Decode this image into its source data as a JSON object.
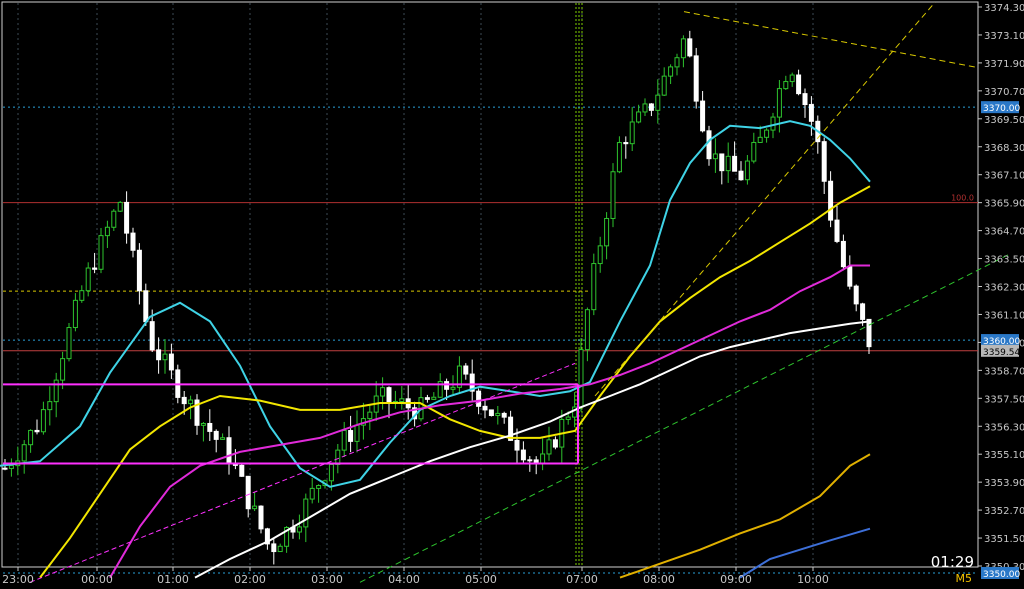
{
  "chart_data": {
    "type": "candlestick",
    "timeframe": "M5",
    "countdown": "01:29",
    "y_range": [
      3349.6,
      3374.5
    ],
    "y_ticks": [
      "3374.30",
      "3373.10",
      "3371.90",
      "3370.70",
      "3369.50",
      "3368.30",
      "3367.10",
      "3365.90",
      "3364.70",
      "3363.50",
      "3362.30",
      "3361.10",
      "3359.90",
      "3358.70",
      "3357.50",
      "3356.30",
      "3355.10",
      "3353.90",
      "3352.70",
      "3351.50",
      "3350.30"
    ],
    "x_ticks": [
      "23:00",
      "00:00",
      "01:00",
      "02:00",
      "03:00",
      "04:00",
      "05:00",
      "07:00",
      "08:00",
      "09:00",
      "10:00"
    ],
    "price_lines": [
      {
        "label": "3370.00",
        "value": 3370.0,
        "color": "#2a78c8"
      },
      {
        "label": "3360.00",
        "value": 3360.0,
        "color": "#2a78c8"
      },
      {
        "label": "3359.54",
        "value": 3359.54,
        "color": "#b0b0b0"
      },
      {
        "label": "3350.00",
        "value": 3350.0,
        "color": "#2a78c8"
      }
    ],
    "fibo_label": "100.0",
    "series": [
      {
        "name": "MA fast",
        "color": "#3fd3e6",
        "points": [
          [
            0,
            3354.6
          ],
          [
            40,
            3354.8
          ],
          [
            80,
            3356.3
          ],
          [
            110,
            3358.6
          ],
          [
            150,
            3361.0
          ],
          [
            180,
            3361.6
          ],
          [
            210,
            3360.8
          ],
          [
            240,
            3358.9
          ],
          [
            270,
            3356.3
          ],
          [
            300,
            3354.5
          ],
          [
            330,
            3353.7
          ],
          [
            360,
            3354.0
          ],
          [
            390,
            3355.6
          ],
          [
            420,
            3357.0
          ],
          [
            450,
            3357.6
          ],
          [
            480,
            3358.0
          ],
          [
            510,
            3357.8
          ],
          [
            540,
            3357.6
          ],
          [
            570,
            3357.8
          ],
          [
            590,
            3358.2
          ],
          [
            620,
            3360.8
          ],
          [
            650,
            3363.2
          ],
          [
            670,
            3366.0
          ],
          [
            690,
            3367.6
          ],
          [
            710,
            3368.6
          ],
          [
            730,
            3369.2
          ],
          [
            760,
            3369.1
          ],
          [
            790,
            3369.4
          ],
          [
            810,
            3369.2
          ],
          [
            830,
            3368.6
          ],
          [
            850,
            3367.8
          ],
          [
            870,
            3366.8
          ]
        ]
      },
      {
        "name": "MA mid",
        "color": "#f2e600",
        "points": [
          [
            40,
            3349.8
          ],
          [
            70,
            3351.5
          ],
          [
            100,
            3353.4
          ],
          [
            130,
            3355.3
          ],
          [
            160,
            3356.3
          ],
          [
            190,
            3357.1
          ],
          [
            220,
            3357.6
          ],
          [
            260,
            3357.4
          ],
          [
            300,
            3357.0
          ],
          [
            340,
            3357.0
          ],
          [
            380,
            3357.3
          ],
          [
            420,
            3357.3
          ],
          [
            450,
            3356.6
          ],
          [
            480,
            3356.1
          ],
          [
            510,
            3355.8
          ],
          [
            540,
            3355.8
          ],
          [
            575,
            3356.1
          ],
          [
            600,
            3357.6
          ],
          [
            630,
            3359.3
          ],
          [
            660,
            3360.8
          ],
          [
            690,
            3361.8
          ],
          [
            720,
            3362.7
          ],
          [
            750,
            3363.4
          ],
          [
            780,
            3364.2
          ],
          [
            810,
            3365.0
          ],
          [
            840,
            3365.9
          ],
          [
            870,
            3366.6
          ]
        ]
      },
      {
        "name": "MA slow",
        "color": "#e02ad9",
        "points": [
          [
            110,
            3349.8
          ],
          [
            140,
            3352.0
          ],
          [
            170,
            3353.7
          ],
          [
            200,
            3354.6
          ],
          [
            240,
            3355.2
          ],
          [
            280,
            3355.5
          ],
          [
            320,
            3355.8
          ],
          [
            360,
            3356.4
          ],
          [
            400,
            3356.9
          ],
          [
            440,
            3357.2
          ],
          [
            480,
            3357.4
          ],
          [
            520,
            3357.7
          ],
          [
            560,
            3357.9
          ],
          [
            590,
            3358.1
          ],
          [
            620,
            3358.5
          ],
          [
            650,
            3359.0
          ],
          [
            680,
            3359.6
          ],
          [
            710,
            3360.2
          ],
          [
            740,
            3360.8
          ],
          [
            770,
            3361.3
          ],
          [
            800,
            3362.1
          ],
          [
            830,
            3362.7
          ],
          [
            850,
            3363.2
          ],
          [
            870,
            3363.2
          ]
        ]
      },
      {
        "name": "MA long",
        "color": "#ffffff",
        "points": [
          [
            195,
            3349.8
          ],
          [
            230,
            3350.6
          ],
          [
            270,
            3351.4
          ],
          [
            310,
            3352.4
          ],
          [
            350,
            3353.4
          ],
          [
            390,
            3354.1
          ],
          [
            430,
            3354.8
          ],
          [
            470,
            3355.4
          ],
          [
            510,
            3355.9
          ],
          [
            550,
            3356.5
          ],
          [
            580,
            3357.1
          ],
          [
            610,
            3357.6
          ],
          [
            640,
            3358.1
          ],
          [
            670,
            3358.7
          ],
          [
            700,
            3359.3
          ],
          [
            730,
            3359.7
          ],
          [
            760,
            3360.0
          ],
          [
            790,
            3360.3
          ],
          [
            820,
            3360.5
          ],
          [
            850,
            3360.7
          ],
          [
            870,
            3360.8
          ]
        ]
      },
      {
        "name": "Envelope upper",
        "color": "#e0b000",
        "points": [
          [
            620,
            3349.8
          ],
          [
            660,
            3350.4
          ],
          [
            700,
            3351.0
          ],
          [
            740,
            3351.7
          ],
          [
            780,
            3352.3
          ],
          [
            820,
            3353.3
          ],
          [
            850,
            3354.6
          ],
          [
            870,
            3355.1
          ]
        ]
      },
      {
        "name": "Envelope lower",
        "color": "#3d6fd8",
        "points": [
          [
            740,
            3349.8
          ],
          [
            770,
            3350.6
          ],
          [
            800,
            3351.0
          ],
          [
            830,
            3351.4
          ],
          [
            870,
            3351.9
          ]
        ]
      }
    ]
  }
}
